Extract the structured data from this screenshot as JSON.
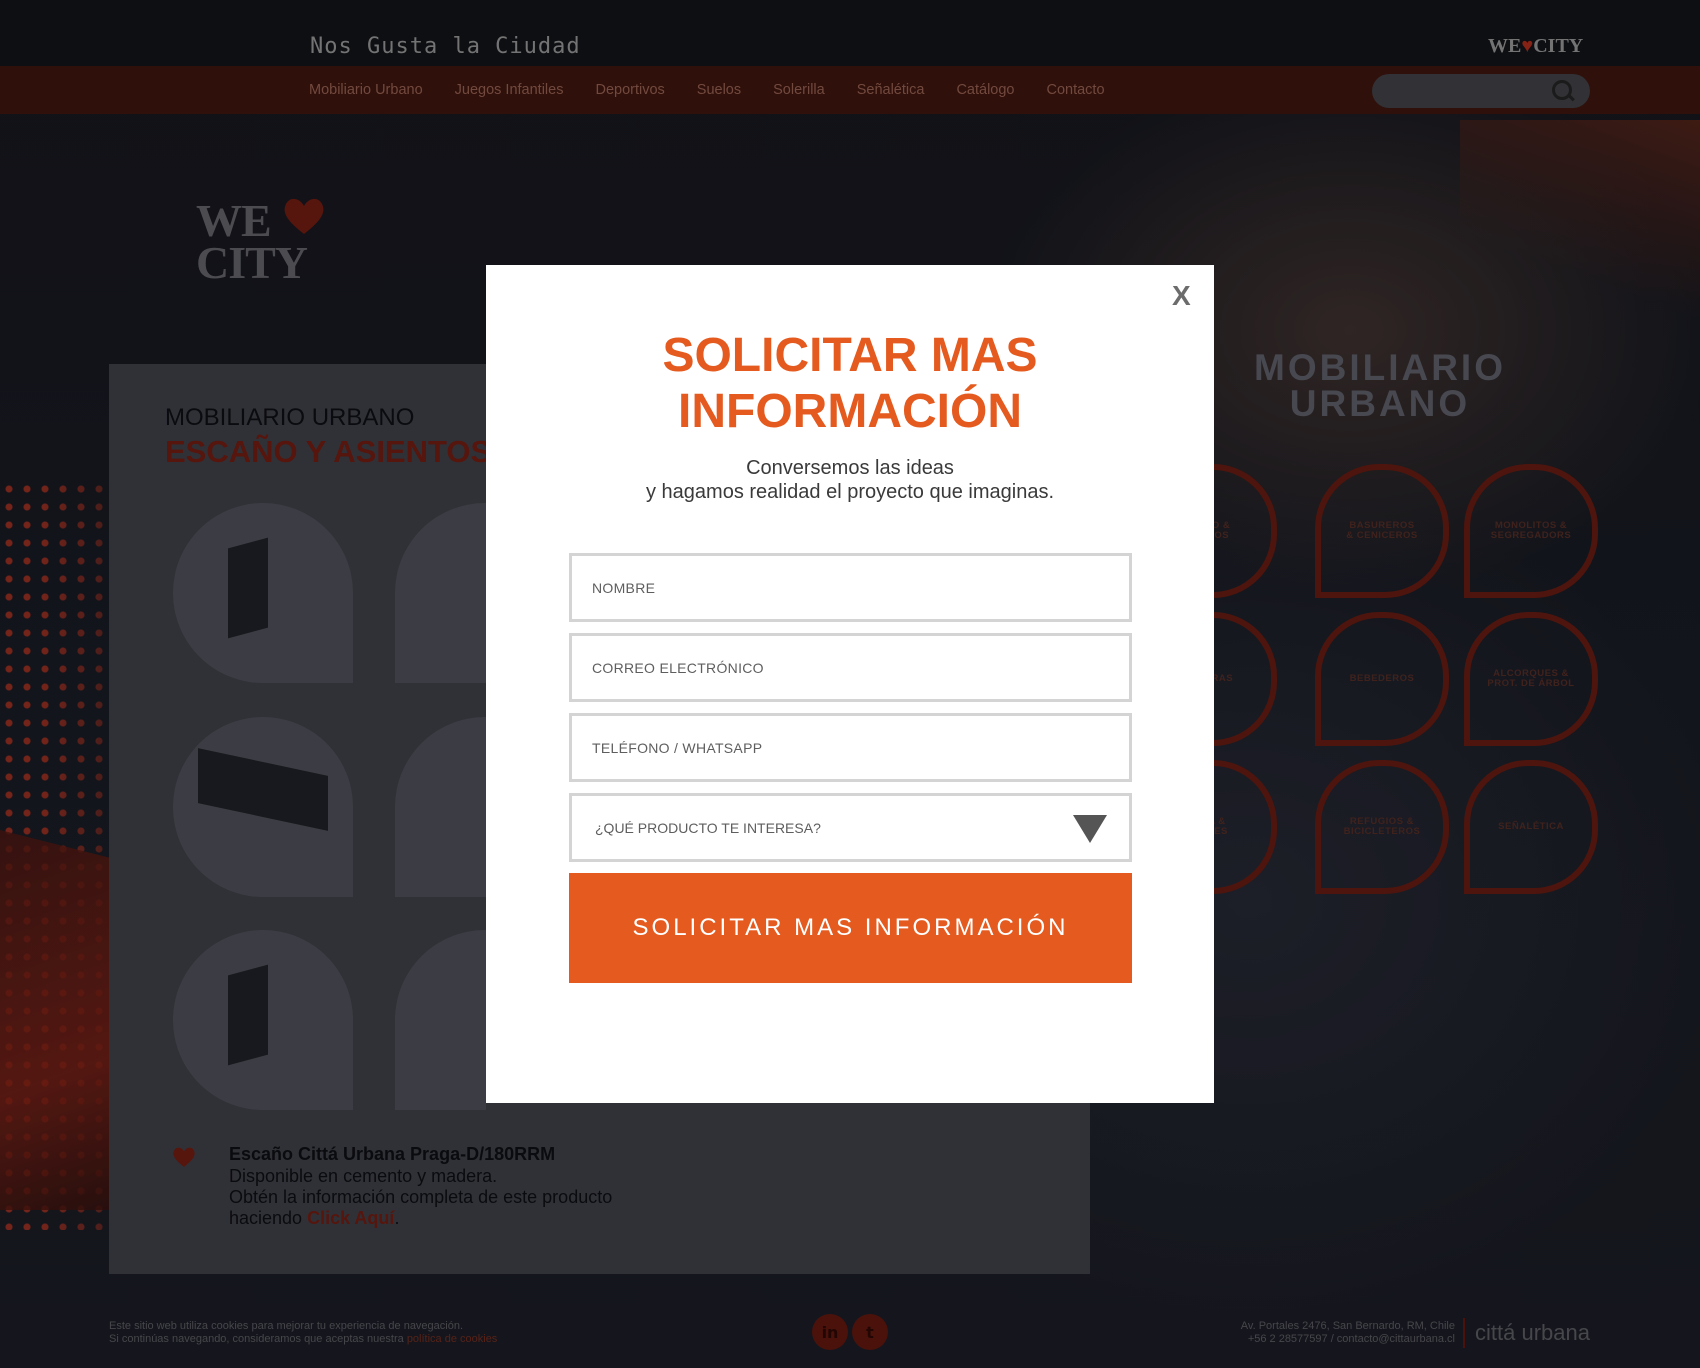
{
  "header": {
    "tagline": "Nos Gusta la Ciudad",
    "brand_we": "WE",
    "brand_city": "CITY"
  },
  "nav": {
    "items": [
      "Mobiliario Urbano",
      "Juegos Infantiles",
      "Deportivos",
      "Suelos",
      "Solerilla",
      "Señalética",
      "Catálogo",
      "Contacto"
    ]
  },
  "search": {
    "placeholder": ""
  },
  "logo": {
    "line1": "WE",
    "line2": "CITY"
  },
  "panel": {
    "category": "MOBILIARIO URBANO",
    "subcategory": "ESCAÑO Y ASIENTOS",
    "product_title": "Escaño Cittá Urbana Praga-D/180RRM",
    "product_line1": "Disponible en cemento y madera.",
    "product_line2": "Obtén la información completa de este producto",
    "product_line3_prefix": "haciendo ",
    "product_link": "Click Aquí",
    "product_line3_suffix": "."
  },
  "sidebar": {
    "title_line1": "MOBILIARIO",
    "title_line2": "URBANO",
    "categories": [
      {
        "line1": "CAÑO &",
        "line2": "IENTOS"
      },
      {
        "line1": "BASUREROS",
        "line2": "& CENICEROS"
      },
      {
        "line1": "MONOLITOS &",
        "line2": "SEGREGADORS"
      },
      {
        "line1": "DINERAS",
        "line2": ""
      },
      {
        "line1": "BEBEDEROS",
        "line2": ""
      },
      {
        "line1": "ALCORQUES &",
        "line2": "PROT. DE ÁRBOL"
      },
      {
        "line1": "ESA &",
        "line2": "SONES"
      },
      {
        "line1": "REFUGIOS &",
        "line2": "BICICLETEROS"
      },
      {
        "line1": "SEÑALÉTICA",
        "line2": ""
      }
    ]
  },
  "footer": {
    "cookies_line1": "Este sitio web utiliza cookies para mejorar tu experiencia de navegación.",
    "cookies_line2": "Si continúas navegando, consideramos que aceptas nuestra ",
    "cookies_link": "política de cookies",
    "linkedin": "in",
    "twitter": "t",
    "address": "Av. Portales 2476, San Bernardo, RM, Chile",
    "contact": "+56 2 28577597 / contacto@cittaurbana.cl",
    "brand": "cittá urbana"
  },
  "modal": {
    "close": "X",
    "title_line1": "SOLICITAR MAS",
    "title_line2": "INFORMACIÓN",
    "subtitle_line1": "Conversemos las ideas",
    "subtitle_line2": "y hagamos realidad el proyecto que imaginas.",
    "name_placeholder": "NOMBRE",
    "email_placeholder": "CORREO ELECTRÓNICO",
    "phone_placeholder": "TELÉFONO / WHATSAPP",
    "product_select": "¿QUÉ PRODUCTO TE INTERESA?",
    "submit": "SOLICITAR MAS INFORMACIÓN"
  },
  "colors": {
    "accent": "#e45a1f",
    "nav_bg": "#3a140d",
    "dark_red": "#5e1a10"
  }
}
